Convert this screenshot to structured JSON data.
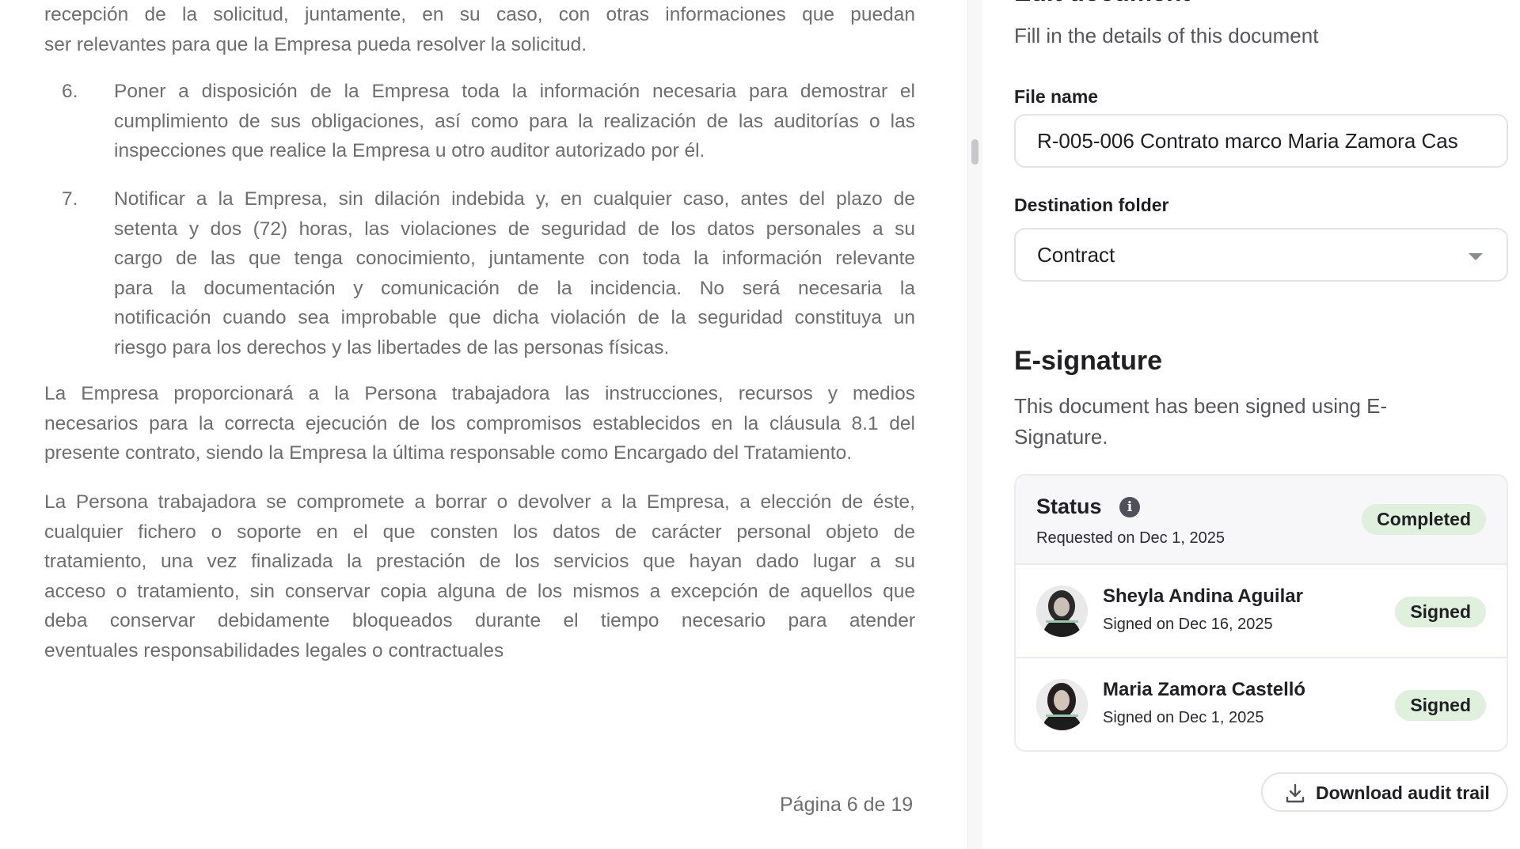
{
  "document": {
    "intro_lines": [
      "recepción de la solicitud, juntamente, en su caso, con otras informaciones que puedan",
      "ser relevantes para que la Empresa pueda resolver la solicitud."
    ],
    "items": [
      {
        "number": "6.",
        "lines": [
          "Poner a disposición de la Empresa toda la información necesaria para demostrar el",
          "cumplimiento de sus obligaciones, así como para la realización de las auditorías o las",
          "inspecciones que realice la Empresa u otro auditor autorizado por él."
        ]
      },
      {
        "number": "7.",
        "lines": [
          "Notificar a la Empresa, sin dilación indebida y, en cualquier caso, antes del plazo de",
          "setenta y dos (72) horas, las violaciones de seguridad de los datos personales a su",
          "cargo de las que tenga conocimiento, juntamente con toda la información relevante",
          "para la documentación y comunicación de la incidencia. No será necesaria la",
          "notificación cuando sea improbable que dicha violación de la seguridad constituya un",
          "riesgo para los derechos y las libertades de las personas físicas."
        ]
      }
    ],
    "paragraphs": [
      {
        "lines": [
          "La Empresa proporcionará a la Persona trabajadora las instrucciones, recursos y medios",
          "necesarios para la correcta ejecución de los compromisos establecidos en la cláusula 8.1 del",
          "presente contrato, siendo la Empresa la última responsable como Encargado del Tratamiento."
        ]
      },
      {
        "lines": [
          "La Persona trabajadora se compromete a borrar o devolver a la Empresa, a elección de éste,",
          "cualquier fichero o soporte en el que consten los datos de carácter personal objeto de",
          "tratamiento, una vez finalizada la prestación de los servicios que hayan dado lugar a su",
          "acceso o tratamiento, sin conservar copia alguna de los mismos a excepción de aquellos que",
          "deba conservar debidamente bloqueados durante el tiempo necesario para atender",
          "eventuales responsabilidades legales o contractuales"
        ]
      }
    ],
    "page_footer": "Página 6 de 19"
  },
  "panel": {
    "heading": "Edit document",
    "subtitle": "Fill in the details of this document",
    "file_name_label": "File name",
    "file_name_value": "R-005-006 Contrato marco Maria Zamora Cas",
    "folder_label": "Destination folder",
    "folder_value": "Contract",
    "esignature": {
      "title": "E-signature",
      "description": "This document has been signed using E-Signature.",
      "status_label": "Status",
      "info_icon": "info-icon",
      "requested": "Requested on Dec 1, 2025",
      "status_badge": "Completed",
      "badge_color": "#dff0dc",
      "signers": [
        {
          "name": "Sheyla Andina Aguilar",
          "date": "Signed on Dec 16, 2025",
          "badge": "Signed"
        },
        {
          "name": "Maria Zamora Castelló",
          "date": "Signed on Dec 1, 2025",
          "badge": "Signed"
        }
      ]
    },
    "download_label": "Download audit trail",
    "download_icon": "download-icon"
  }
}
